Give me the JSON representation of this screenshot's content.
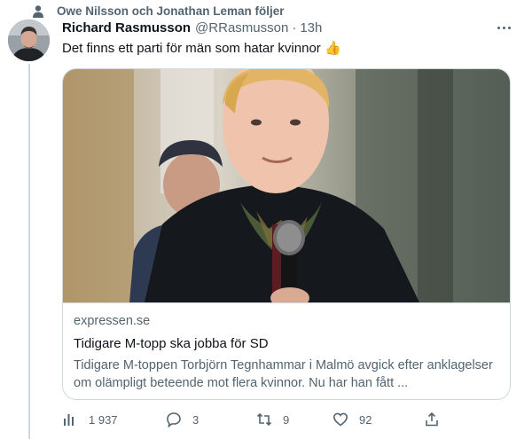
{
  "social_context": {
    "text": "Owe Nilsson och Jonathan Leman följer"
  },
  "tweet": {
    "author_name": "Richard Rasmusson",
    "author_handle": "@RRasmusson",
    "separator": "·",
    "time": "13h",
    "text": "Det finns ett parti för män som hatar kvinnor 👍"
  },
  "card": {
    "domain": "expressen.se",
    "title": "Tidigare M-topp ska jobba för SD",
    "description": "Tidigare M-toppen Torbjörn Tegnhammar i Malmö avgick efter anklagelser om olämpligt beteende mot flera kvinnor. Nu har han fått ..."
  },
  "actions": {
    "views": "1 937",
    "replies": "3",
    "retweets": "9",
    "likes": "92"
  },
  "colors": {
    "text": "#0f1419",
    "secondary": "#536471",
    "border": "#cfd9de"
  }
}
